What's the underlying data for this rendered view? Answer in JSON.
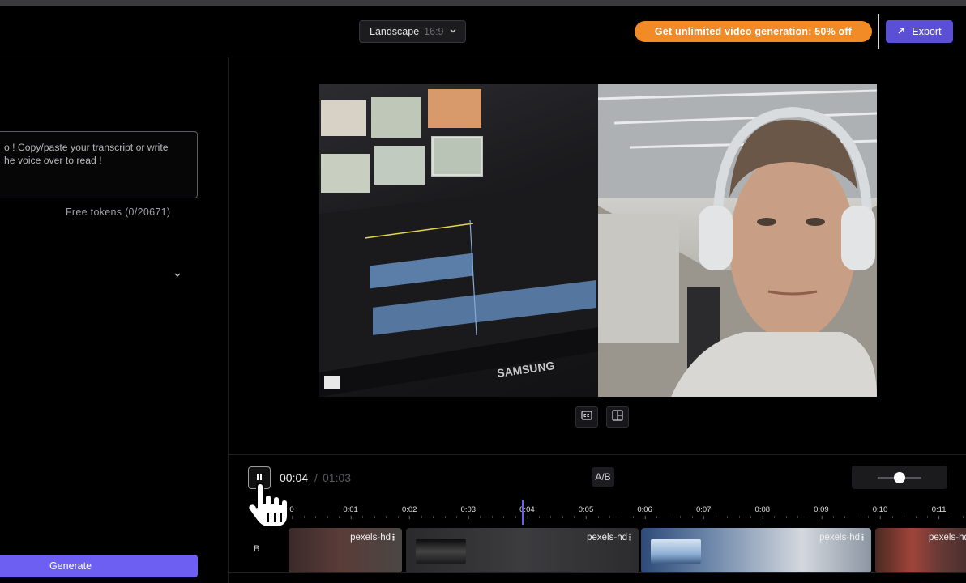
{
  "header": {
    "aspect": {
      "label": "Landscape",
      "ratio": "16:9"
    },
    "promo_label": "Get unlimited video generation: 50% off",
    "export_label": "Export"
  },
  "left_panel": {
    "script_placeholder": "o ! Copy/paste your transcript or write\nhe voice over to read !",
    "tokens_label": "Free tokens (0/20671)",
    "generate_label": "Generate"
  },
  "player": {
    "current_time": "00:04",
    "separator": "/",
    "total_time": "01:03",
    "ab_label": "A/B",
    "progress_fraction": 0.063
  },
  "timeline": {
    "track_label": "B",
    "ticks": [
      "0",
      "0:01",
      "0:02",
      "0:03",
      "0:04",
      "0:05",
      "0:06",
      "0:07",
      "0:08",
      "0:09",
      "0:10",
      "0:11"
    ],
    "clips": [
      {
        "name": "pexels-hd"
      },
      {
        "name": "pexels-hd"
      },
      {
        "name": "pexels-hd"
      },
      {
        "name": "pexels-hd"
      }
    ]
  },
  "colors": {
    "accent": "#5b4fd6",
    "promo": "#f28b25",
    "background": "#000000"
  },
  "icons": [
    "chevron-down-icon",
    "export-arrow-icon",
    "pause-icon",
    "captions-icon",
    "layout-icon",
    "hand-pointer-icon"
  ],
  "preview": {
    "left_screen_text": "SAMSUNG"
  }
}
